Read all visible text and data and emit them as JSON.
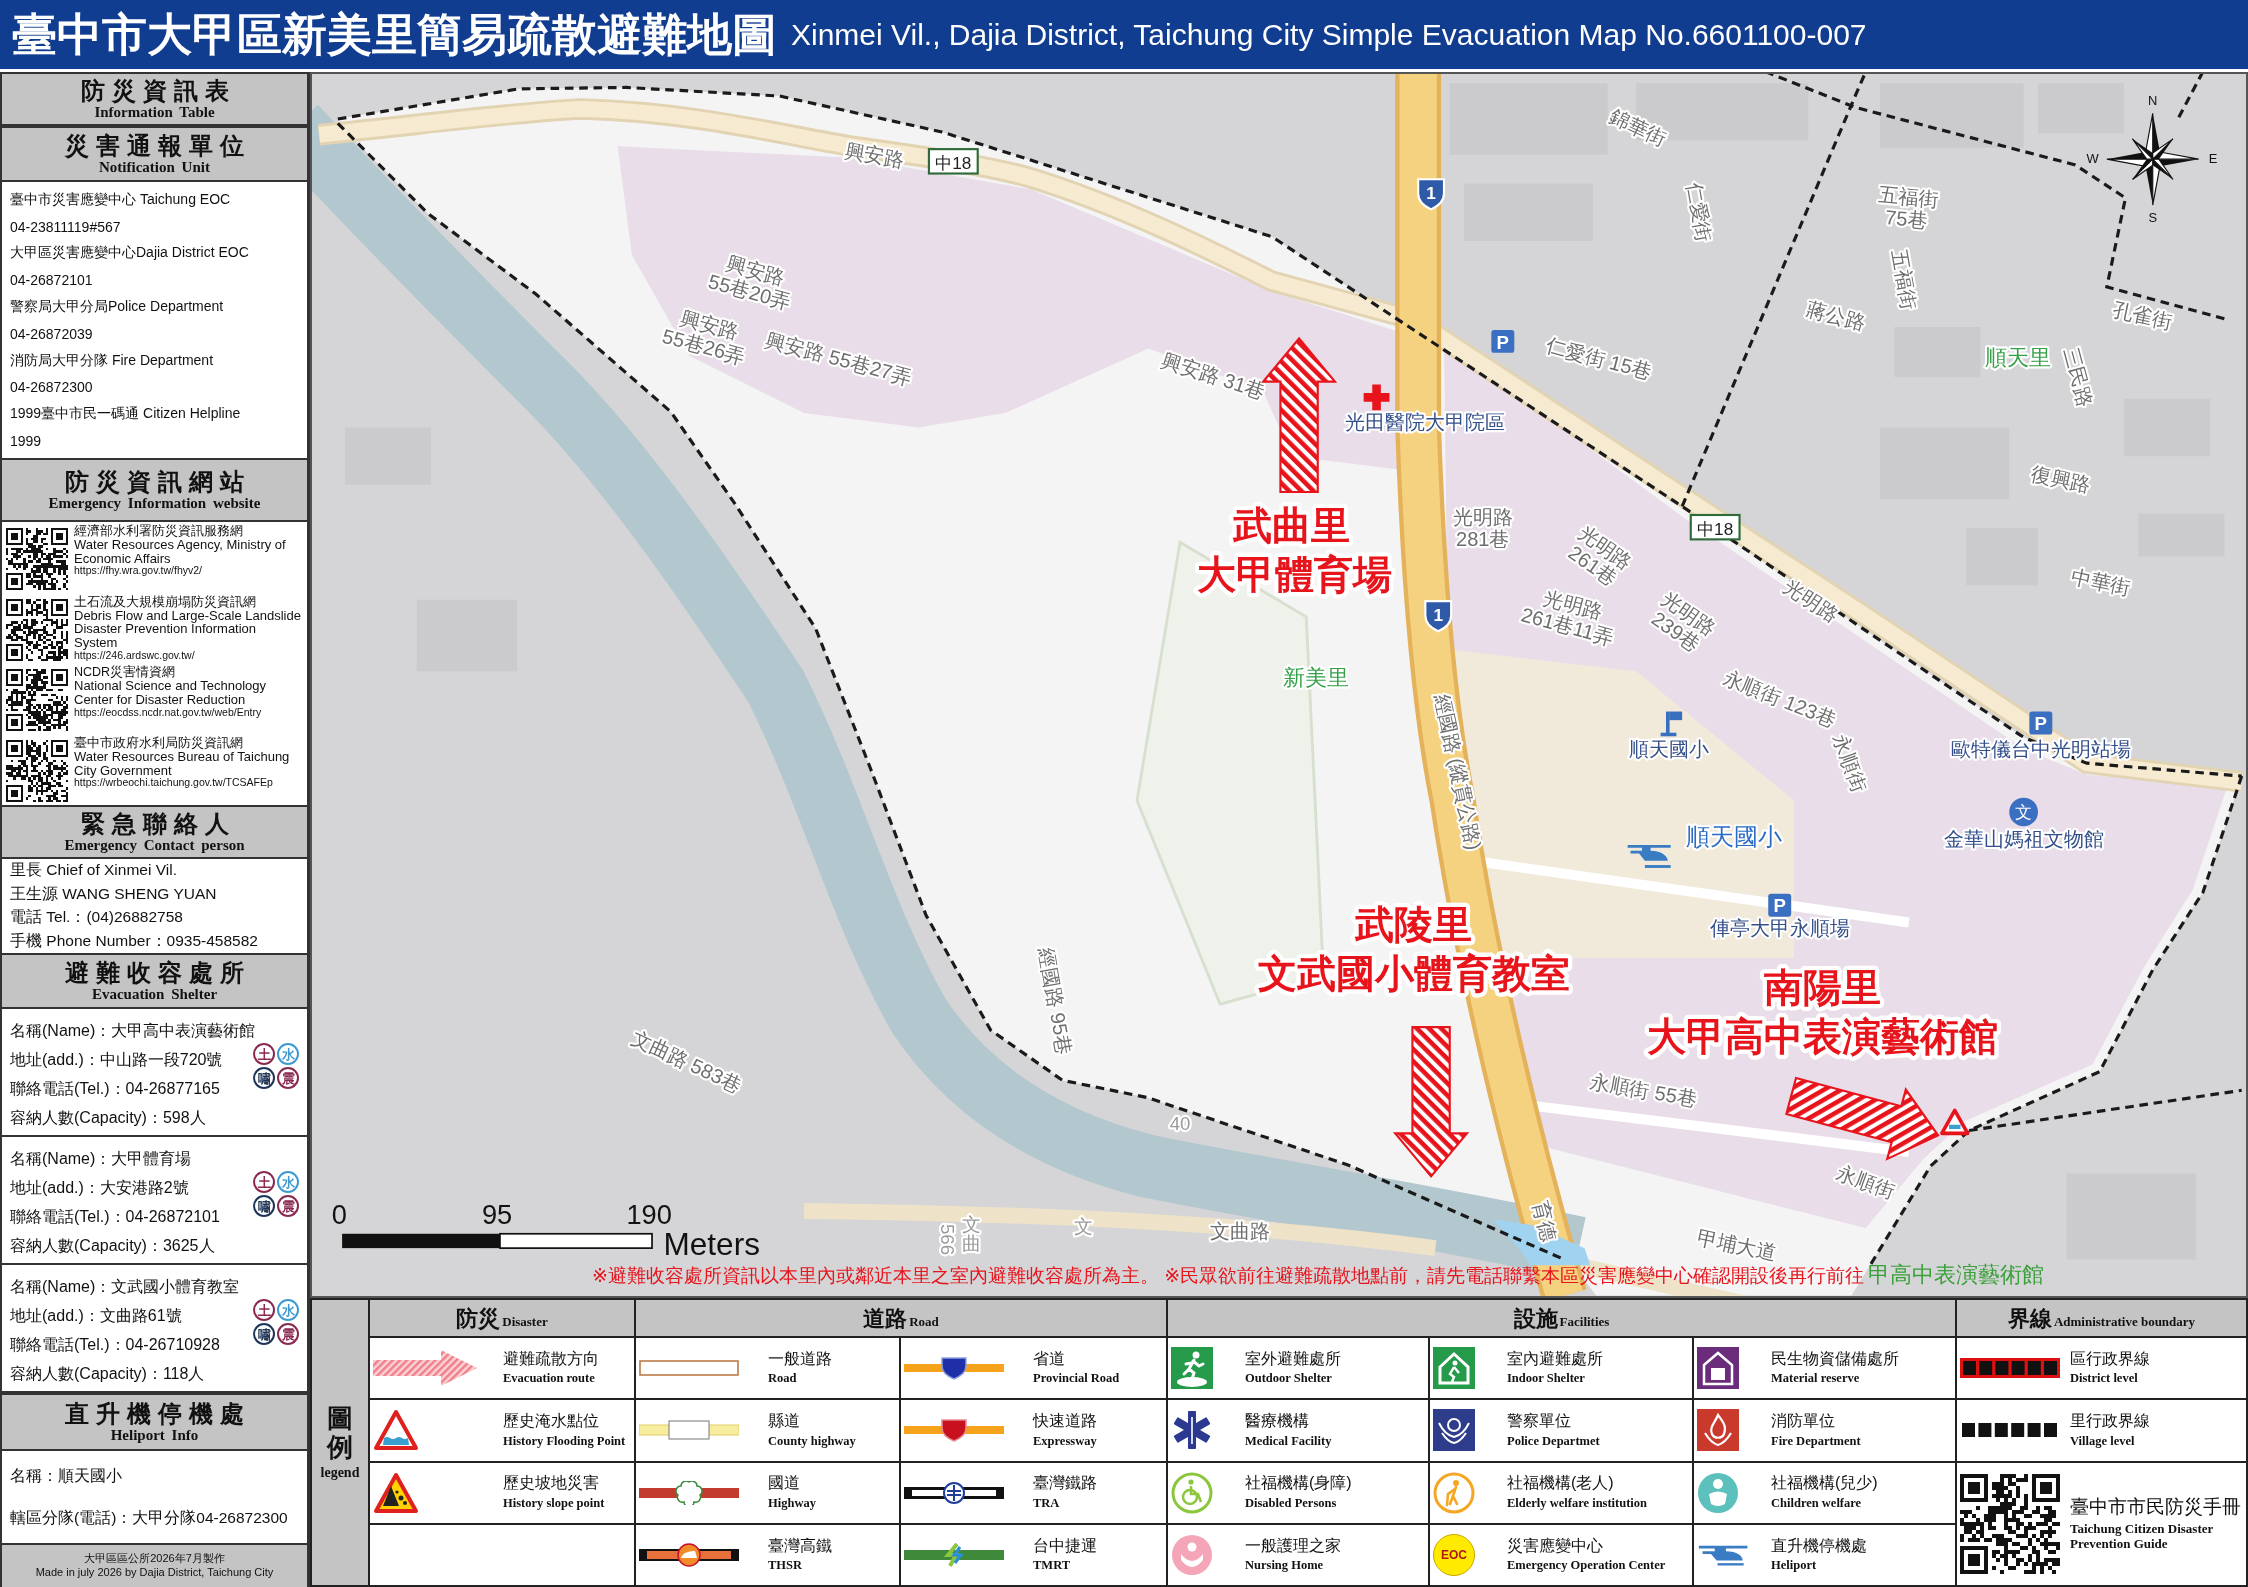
{
  "title": {
    "zh": "臺中市大甲區新美里簡易疏散避難地圖",
    "en": "Xinmei Vil., Dajia District, Taichung City Simple Evacuation Map No.6601100-007"
  },
  "info_panel": {
    "header": {
      "zh": "防災資訊表",
      "en": "Information Table"
    },
    "notification": {
      "header": {
        "zh": "災害通報單位",
        "en": "Notification Unit"
      },
      "lines": [
        "臺中市災害應變中心 Taichung EOC",
        "04-23811119#567",
        "大甲區災害應變中心Dajia District EOC",
        "04-26872101",
        "警察局大甲分局Police Department",
        "04-26872039",
        "消防局大甲分隊 Fire Department",
        "04-26872300",
        "1999臺中市民一碼通 Citizen Helpline",
        "1999"
      ]
    },
    "websites": {
      "header": {
        "zh": "防災資訊網站",
        "en": "Emergency Information website"
      },
      "items": [
        {
          "zh": "經濟部水利署防災資訊服務網",
          "en": "Water Resources Agency, Ministry of Economic Affairs",
          "url": "https://fhy.wra.gov.tw/fhyv2/"
        },
        {
          "zh": "土石流及大規模崩塌防災資訊網",
          "en": "Debris Flow and Large-Scale Landslide Disaster Prevention Information System",
          "url": "https://246.ardswc.gov.tw/"
        },
        {
          "zh": "NCDR災害情資網",
          "en": "National Science and Technology Center for Disaster Reduction",
          "url": "https://eocdss.ncdr.nat.gov.tw/web/Entry"
        },
        {
          "zh": "臺中市政府水利局防災資訊網",
          "en": "Water Resources Bureau of Taichung City Government",
          "url": "https://wrbeochi.taichung.gov.tw/TCSAFEp"
        }
      ]
    },
    "contact": {
      "header": {
        "zh": "緊急聯絡人",
        "en": "Emergency Contact person"
      },
      "lines": [
        "里長 Chief of Xinmei Vil.",
        "王生源 WANG SHENG YUAN",
        "電話 Tel.：(04)26882758",
        "手機 Phone Number：0935-458582"
      ]
    },
    "shelters": {
      "header": {
        "zh": "避難收容處所",
        "en": "Evacuation Shelter"
      },
      "items": [
        {
          "lines": [
            "名稱(Name)：大甲高中表演藝術館",
            "地址(add.)：中山路一段720號",
            "聯絡電話(Tel.)：04-26877165",
            "容納人數(Capacity)：598人"
          ],
          "hazards": [
            {
              "label": "土",
              "color": "#8a2a52"
            },
            {
              "label": "水",
              "color": "#3d9ad1"
            },
            {
              "label": "嘯",
              "color": "#1f3557"
            },
            {
              "label": "震",
              "color": "#8a2a52"
            }
          ]
        },
        {
          "lines": [
            "名稱(Name)：大甲體育場",
            "地址(add.)：大安港路2號",
            "聯絡電話(Tel.)：04-26872101",
            "容納人數(Capacity)：3625人"
          ],
          "hazards": [
            {
              "label": "土",
              "color": "#8a2a52"
            },
            {
              "label": "水",
              "color": "#3d9ad1"
            },
            {
              "label": "嘯",
              "color": "#1f3557"
            },
            {
              "label": "震",
              "color": "#8a2a52"
            }
          ]
        },
        {
          "lines": [
            "名稱(Name)：文武國小體育教室",
            "地址(add.)：文曲路61號",
            "聯絡電話(Tel.)：04-26710928",
            "容納人數(Capacity)：118人"
          ],
          "hazards": [
            {
              "label": "土",
              "color": "#8a2a52"
            },
            {
              "label": "水",
              "color": "#3d9ad1"
            },
            {
              "label": "嘯",
              "color": "#1f3557"
            },
            {
              "label": "震",
              "color": "#8a2a52"
            }
          ]
        }
      ]
    },
    "heliport": {
      "header": {
        "zh": "直升機停機處",
        "en": "Heliport Info"
      },
      "lines": [
        "名稱：順天國小",
        "轄區分隊(電話)：大甲分隊04-26872300"
      ]
    },
    "footer": [
      "大甲區區公所2026年7月製作",
      "Made in july 2026 by Dajia District, Taichung City"
    ]
  },
  "map": {
    "labels": [
      {
        "kind": "street",
        "lines": [
          "興安路"
        ]
      },
      {
        "kind": "street",
        "lines": [
          "興安路",
          "55巷20弄"
        ]
      },
      {
        "kind": "street",
        "lines": [
          "興安路",
          "55巷26弄"
        ]
      },
      {
        "kind": "street",
        "lines": [
          "興安路 55巷27弄"
        ]
      },
      {
        "kind": "street",
        "lines": [
          "興安路 31巷"
        ]
      },
      {
        "kind": "street",
        "lines": [
          "仁愛街 15巷"
        ]
      },
      {
        "kind": "street",
        "lines": [
          "錦華街"
        ]
      },
      {
        "kind": "street",
        "lines": [
          "五福街",
          "75巷"
        ]
      },
      {
        "kind": "street",
        "lines": [
          "五福街"
        ]
      },
      {
        "kind": "street",
        "lines": [
          "孔雀街"
        ]
      },
      {
        "kind": "street",
        "lines": [
          "光明路",
          "281巷"
        ]
      },
      {
        "kind": "street",
        "lines": [
          "光明路",
          "261巷"
        ]
      },
      {
        "kind": "street",
        "lines": [
          "光明路",
          "261巷11弄"
        ]
      },
      {
        "kind": "street",
        "lines": [
          "光明路",
          "239巷"
        ]
      },
      {
        "kind": "street",
        "lines": [
          "永順街 123巷"
        ]
      },
      {
        "kind": "street",
        "lines": [
          "永順街"
        ]
      },
      {
        "kind": "street",
        "lines": [
          "經國路 (縱貫公路)"
        ]
      },
      {
        "kind": "street",
        "lines": [
          "文曲路 583巷"
        ]
      },
      {
        "kind": "street",
        "lines": [
          "經國路 95巷"
        ]
      },
      {
        "kind": "street",
        "lines": [
          "永順街 55巷"
        ]
      },
      {
        "kind": "street",
        "lines": [
          "永順街"
        ]
      },
      {
        "kind": "street",
        "lines": [
          "文曲路"
        ]
      },
      {
        "kind": "street",
        "lines": [
          "甲埔大道"
        ]
      },
      {
        "kind": "place",
        "lines": [
          "光田醫院大甲院區"
        ]
      },
      {
        "kind": "place",
        "lines": [
          "順天國小"
        ]
      },
      {
        "kind": "school",
        "lines": [
          "順天國小"
        ]
      },
      {
        "kind": "place",
        "lines": [
          "金華山媽祖文物館"
        ]
      },
      {
        "kind": "village",
        "lines": [
          "新美里"
        ]
      },
      {
        "kind": "village",
        "lines": [
          "順天里"
        ]
      },
      {
        "kind": "street",
        "lines": [
          "光明路"
        ]
      },
      {
        "kind": "place",
        "lines": [
          "俥亭大甲永順場"
        ]
      },
      {
        "kind": "street",
        "lines": [
          "仁愛街"
        ]
      },
      {
        "kind": "street",
        "lines": [
          "蔣公路"
        ]
      },
      {
        "kind": "street",
        "lines": [
          "三民路"
        ]
      },
      {
        "kind": "street",
        "lines": [
          "復興路"
        ]
      },
      {
        "kind": "street",
        "lines": [
          "中華街"
        ]
      },
      {
        "kind": "place",
        "lines": [
          "歐特儀台中光明站場"
        ]
      },
      {
        "kind": "faint",
        "lines": [
          "40"
        ]
      },
      {
        "kind": "faint",
        "lines": [
          "566"
        ]
      },
      {
        "kind": "faint",
        "lines": [
          "文曲"
        ]
      },
      {
        "kind": "faint",
        "lines": [
          "文"
        ]
      },
      {
        "kind": "street",
        "lines": [
          "育德"
        ]
      }
    ],
    "markers": [
      {
        "kind": "shield",
        "text": "1"
      },
      {
        "kind": "shield",
        "text": "1"
      },
      {
        "kind": "route_sign",
        "text": "中18"
      },
      {
        "kind": "route_sign",
        "text": "中18"
      },
      {
        "kind": "parking",
        "text": "P"
      },
      {
        "kind": "parking",
        "text": "P"
      },
      {
        "kind": "parking",
        "text": "P"
      },
      {
        "kind": "school_badge",
        "text": "文"
      },
      {
        "kind": "hospital"
      },
      {
        "kind": "flag"
      },
      {
        "kind": "heliport"
      },
      {
        "kind": "flood"
      }
    ],
    "shelters": [
      {
        "village": "武曲里",
        "name": "大甲體育場"
      },
      {
        "village": "武陵里",
        "name": "文武國小體育教室"
      },
      {
        "village": "南陽里",
        "name": "大甲高中表演藝術館"
      }
    ],
    "compass": [
      "N",
      "E",
      "S",
      "W"
    ],
    "scale": {
      "ticks": [
        "0",
        "95",
        "190"
      ],
      "unit": "Meters"
    },
    "note": {
      "text": "※避難收容處所資訊以本里內或鄰近本里之室內避難收容處所為主。 ※民眾欲前往避難疏散地點前，請先電話聯繫本區災害應變中心確認開設後再行前往",
      "highlight": "甲高中表演藝術館"
    }
  },
  "legend": {
    "title": {
      "zh": "圖例",
      "en": "legend"
    },
    "groups": [
      {
        "zh": "防災",
        "en": "Disaster",
        "columns": [
          [
            {
              "kind": "evac_arrow",
              "zh": "避難疏散方向",
              "en": "Evacuation route"
            },
            {
              "kind": "flood",
              "zh": "歷史淹水點位",
              "en": "History Flooding Point"
            },
            {
              "kind": "slope",
              "zh": "歷史坡地災害",
              "en": "History slope point"
            }
          ]
        ]
      },
      {
        "zh": "道路",
        "en": "Road",
        "columns": [
          [
            {
              "kind": "road",
              "zh": "一般道路",
              "en": "Road"
            },
            {
              "kind": "county_road",
              "zh": "縣道",
              "en": "County highway"
            },
            {
              "kind": "highway",
              "zh": "國道",
              "en": "Highway"
            },
            {
              "kind": "thsr",
              "zh": "臺灣高鐵",
              "en": "THSR"
            }
          ],
          [
            {
              "kind": "provincial",
              "zh": "省道",
              "en": "Provincial Road"
            },
            {
              "kind": "expressway",
              "zh": "快速道路",
              "en": "Expressway"
            },
            {
              "kind": "tra",
              "zh": "臺灣鐵路",
              "en": "TRA"
            },
            {
              "kind": "tmrt",
              "zh": "台中捷運",
              "en": "TMRT"
            }
          ]
        ]
      },
      {
        "zh": "設施",
        "en": "Facilities",
        "columns": [
          [
            {
              "kind": "outdoor_shelter",
              "zh": "室外避難處所",
              "en": "Outdoor Shelter"
            },
            {
              "kind": "medical",
              "zh": "醫療機構",
              "en": "Medical Facility"
            },
            {
              "kind": "disabled",
              "zh": "社福機構(身障)",
              "en": "Disabled Persons"
            },
            {
              "kind": "nursing",
              "zh": "一般護理之家",
              "en": "Nursing Home"
            }
          ],
          [
            {
              "kind": "indoor_shelter",
              "zh": "室內避難處所",
              "en": "Indoor Shelter"
            },
            {
              "kind": "police",
              "zh": "警察單位",
              "en": "Police Departmet"
            },
            {
              "kind": "elderly",
              "zh": "社福機構(老人)",
              "en": "Elderly welfare institution"
            },
            {
              "kind": "eoc",
              "badge": "EOC",
              "zh": "災害應變中心",
              "en": "Emergency Operation Center"
            }
          ],
          [
            {
              "kind": "material",
              "zh": "民生物資儲備處所",
              "en": "Material reserve"
            },
            {
              "kind": "fire",
              "zh": "消防單位",
              "en": "Fire Department"
            },
            {
              "kind": "children",
              "zh": "社福機構(兒少)",
              "en": "Children welfare"
            },
            {
              "kind": "heliport",
              "zh": "直升機停機處",
              "en": "Heliport"
            }
          ]
        ]
      },
      {
        "zh": "界線",
        "en": "Administrative boundary",
        "columns": [
          [
            {
              "kind": "district_line",
              "zh": "區行政界線",
              "en": "District level"
            },
            {
              "kind": "village_line",
              "zh": "里行政界線",
              "en": "Village level"
            },
            {
              "kind": "qr",
              "zh": "臺中市市民防災手冊",
              "en": "Taichung Citizen Disaster Prevention Guide"
            }
          ]
        ]
      }
    ]
  }
}
